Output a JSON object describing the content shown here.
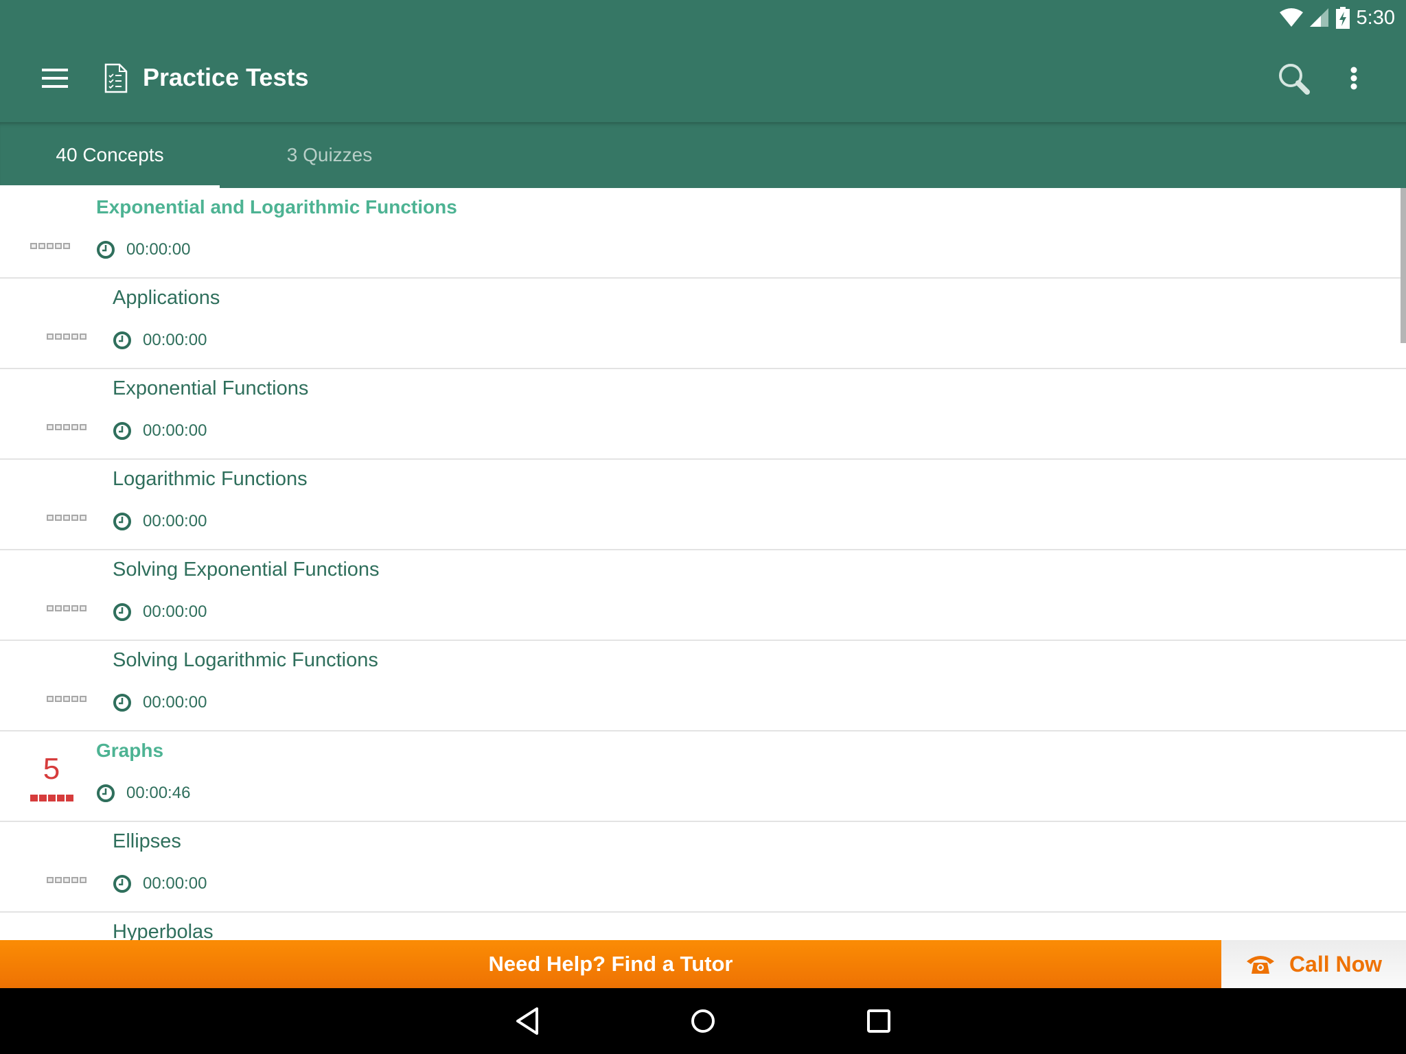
{
  "status_bar": {
    "time": "5:30"
  },
  "app_bar": {
    "title": "Practice Tests"
  },
  "tabs": [
    {
      "label": "40 Concepts",
      "active": true
    },
    {
      "label": "3 Quizzes",
      "active": false
    }
  ],
  "list": [
    {
      "type": "header",
      "name": "Exponential and Logarithmic Functions",
      "time": "00:00:00",
      "score": null
    },
    {
      "type": "sub",
      "name": "Applications",
      "time": "00:00:00",
      "score": null
    },
    {
      "type": "sub",
      "name": "Exponential Functions",
      "time": "00:00:00",
      "score": null
    },
    {
      "type": "sub",
      "name": "Logarithmic Functions",
      "time": "00:00:00",
      "score": null
    },
    {
      "type": "sub",
      "name": "Solving Exponential Functions",
      "time": "00:00:00",
      "score": null
    },
    {
      "type": "sub",
      "name": "Solving Logarithmic Functions",
      "time": "00:00:00",
      "score": null
    },
    {
      "type": "header",
      "name": "Graphs",
      "time": "00:00:46",
      "score": "5"
    },
    {
      "type": "sub",
      "name": "Ellipses",
      "time": "00:00:00",
      "score": null
    },
    {
      "type": "sub",
      "name": "Hyperbolas",
      "time": "",
      "score": null
    }
  ],
  "tutor_bar": {
    "label": "Need Help? Find a Tutor",
    "call_label": "Call Now"
  },
  "colors": {
    "primary": "#367765",
    "accent": "#4db393",
    "orange": "#ee7203",
    "score_red": "#d63c3c"
  }
}
